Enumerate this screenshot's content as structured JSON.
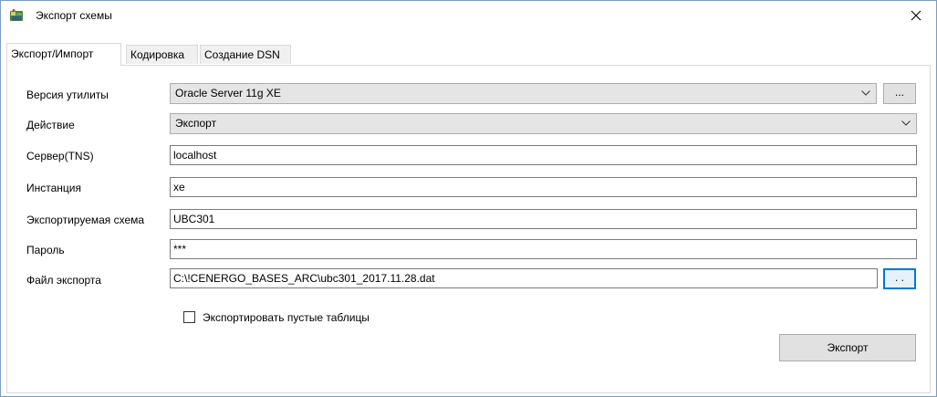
{
  "window": {
    "title": "Экспорт схемы"
  },
  "tabs": [
    {
      "label": "Экспорт/Импорт",
      "active": true
    },
    {
      "label": "Кодировка",
      "active": false
    },
    {
      "label": "Создание DSN",
      "active": false
    }
  ],
  "form": {
    "utility_version": {
      "label": "Версия утилиты",
      "value": "Oracle Server 11g XE",
      "browse_label": "..."
    },
    "action": {
      "label": "Действие",
      "value": "Экспорт"
    },
    "server": {
      "label": "Сервер(TNS)",
      "value": "localhost"
    },
    "instance": {
      "label": "Инстанция",
      "value": "xe"
    },
    "schema": {
      "label": "Экспортируемая схема",
      "value": "UBC301"
    },
    "password": {
      "label": "Пароль",
      "value": "***"
    },
    "export_file": {
      "label": "Файл экспорта",
      "value": "C:\\!CENERGO_BASES_ARC\\ubc301_2017.11.28.dat",
      "browse_label": ". ."
    },
    "empty_tables": {
      "label": "Экспортировать пустые таблицы",
      "checked": false
    }
  },
  "actions": {
    "export_label": "Экспорт"
  },
  "colors": {
    "combo_bg": "#e5e5e5",
    "focus_accent": "#0078d7",
    "window_border": "#7a9cc6"
  }
}
